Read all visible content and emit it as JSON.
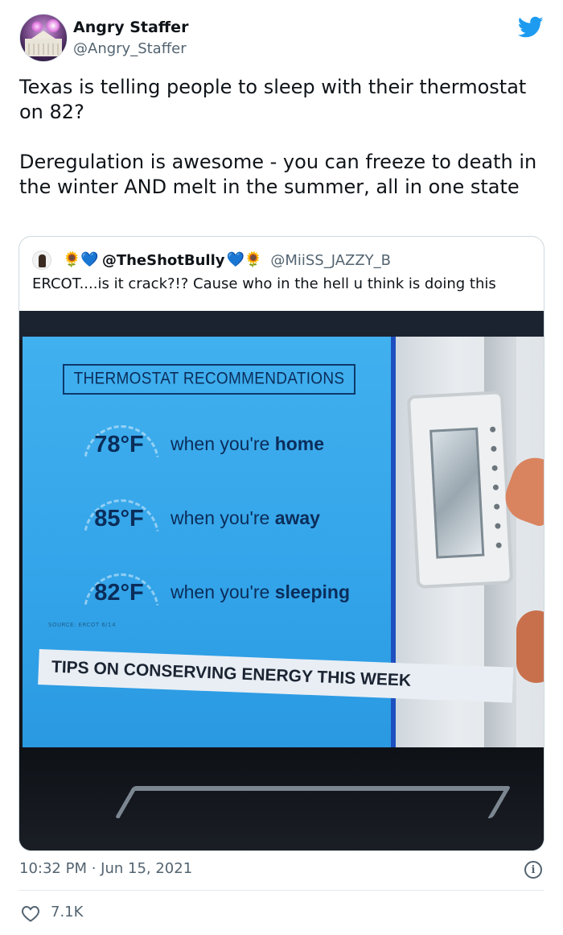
{
  "tweet": {
    "display_name": "Angry Staffer",
    "handle": "@Angry_Staffer",
    "text": [
      "Texas is telling people to sleep with their thermostat on 82?",
      "Deregulation is awesome - you can freeze to death in the winter AND melt in the summer, all in one state"
    ],
    "timestamp": "10:32 PM · Jun 15, 2021",
    "likes": "7.1K"
  },
  "quoted_tweet": {
    "name_prefix_emoji": "🌻💙",
    "name": "@TheShotBully",
    "name_suffix_emoji": "💙🌻",
    "handle": "@MiiSS_JAZZY_B",
    "text": "ERCOT....is it crack?!? Cause who in the hell u think is doing this"
  },
  "photo": {
    "heading": "THERMOSTAT RECOMMENDATIONS",
    "recommendations": [
      {
        "temp": "78°F",
        "text_prefix": "when you're ",
        "text_bold": "home"
      },
      {
        "temp": "85°F",
        "text_prefix": "when you're ",
        "text_bold": "away"
      },
      {
        "temp": "82°F",
        "text_prefix": "when you're ",
        "text_bold": "sleeping"
      }
    ],
    "source": "SOURCE: ERCOT 6/14",
    "banner": "TIPS ON CONSERVING ENERGY THIS WEEK"
  },
  "colors": {
    "twitter_blue": "#1d9bf0",
    "text_primary": "#0f1419",
    "text_secondary": "#536471",
    "border": "#cfd9de"
  },
  "icons": [
    "twitter-bird-icon",
    "info-icon",
    "heart-icon"
  ]
}
